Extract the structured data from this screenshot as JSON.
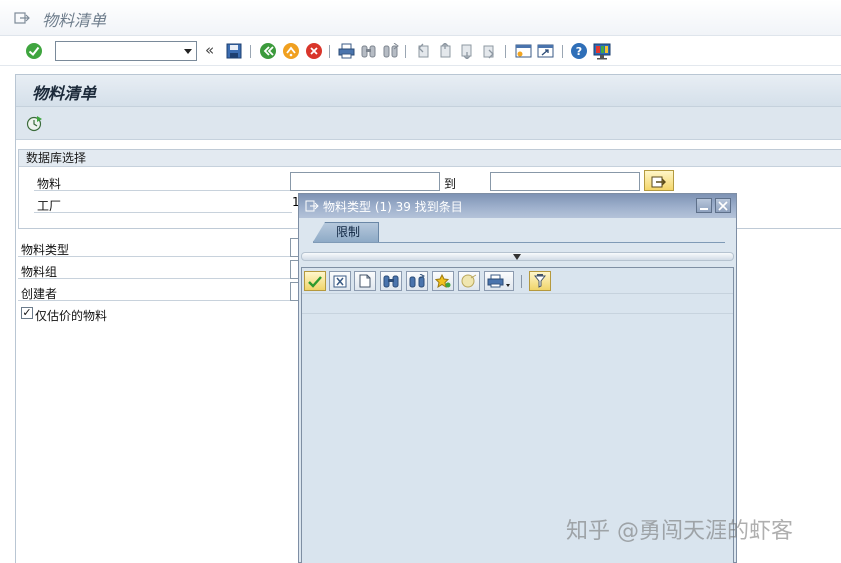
{
  "window": {
    "title": "物料清单"
  },
  "toolbar": {
    "command_value": "",
    "buttons": [
      "enter-icon",
      "save-icon",
      "back-icon",
      "exit-icon",
      "cancel-icon",
      "print-icon",
      "find-icon",
      "find-next-icon",
      "first-page-icon",
      "prev-page-icon",
      "next-page-icon",
      "last-page-icon",
      "create-session-icon",
      "shortcut-icon",
      "help-icon",
      "layout-icon"
    ],
    "chevron": "«"
  },
  "screen": {
    "title": "物料清单",
    "execute_icon": "execute-icon"
  },
  "selection": {
    "group_title": "数据库选择",
    "material_label": "物料",
    "to_label": "到",
    "plant_label": "工厂",
    "plant_value": "1",
    "material_type_label": "物料类型",
    "material_group_label": "物料组",
    "created_by_label": "创建者",
    "valuated_only_label": "仅估价的物料",
    "valuated_only_checked": "✓"
  },
  "dialog": {
    "title": "物料类型 (1)   39 找到条目",
    "tab_label": "限制",
    "toolbar_icons": [
      "ok-icon",
      "cancel-icon",
      "new-icon",
      "find-icon",
      "find-next-icon",
      "favorite-icon",
      "info-icon",
      "print-icon",
      "filter-icon"
    ]
  },
  "watermark": "知乎 @勇闯天涯的虾客",
  "colors": {
    "accent": "#7e93b4",
    "field_border": "#8898a8",
    "dialog_bg": "#dce6ef"
  }
}
